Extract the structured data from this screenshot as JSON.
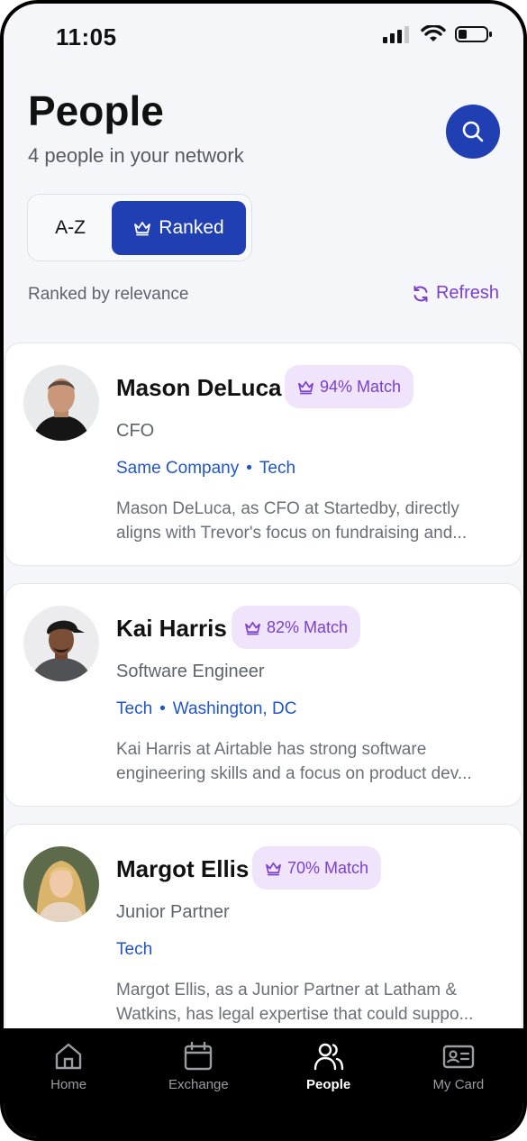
{
  "status_bar": {
    "time": "11:05"
  },
  "header": {
    "title": "People",
    "subtitle": "4 people in your network"
  },
  "sort_toggle": {
    "options": [
      "A-Z",
      "Ranked"
    ],
    "selected": "Ranked"
  },
  "ranking": {
    "label": "Ranked by relevance",
    "refresh_label": "Refresh"
  },
  "people": [
    {
      "name": "Mason DeLuca",
      "match": "94% Match",
      "role": "CFO",
      "tags": [
        "Same Company",
        "Tech"
      ],
      "description": [
        "Mason DeLuca, as CFO at Startedby, directly",
        "aligns with Trevor's focus on fundraising and..."
      ]
    },
    {
      "name": "Kai Harris",
      "match": "82% Match",
      "role": "Software Engineer",
      "tags": [
        "Tech",
        "Washington, DC"
      ],
      "description": [
        "Kai Harris at Airtable has strong software",
        "engineering skills and a focus on product dev..."
      ]
    },
    {
      "name": "Margot Ellis",
      "match": "70% Match",
      "role": "Junior Partner",
      "tags": [
        "Tech"
      ],
      "description": [
        "Margot Ellis, as a Junior Partner at Latham &",
        "Watkins, has legal expertise that could suppo..."
      ]
    }
  ],
  "tabs": [
    {
      "label": "Home",
      "icon": "home-icon"
    },
    {
      "label": "Exchange",
      "icon": "calendar-icon"
    },
    {
      "label": "People",
      "icon": "people-icon",
      "active": true
    },
    {
      "label": "My Card",
      "icon": "id-card-icon"
    }
  ],
  "colors": {
    "primary": "#1f3fb3",
    "accent_purple": "#7b3fd0",
    "badge_bg": "#efe4fb",
    "tag_blue": "#1f55c9"
  }
}
